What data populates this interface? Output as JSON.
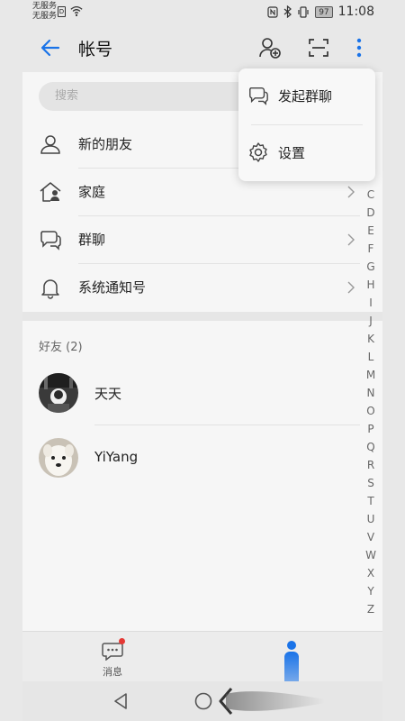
{
  "status_bar": {
    "carrier_line1": "无服务",
    "carrier_line2": "无服务",
    "battery": "97",
    "time": "11:08"
  },
  "header": {
    "title": "帐号",
    "back_icon": "arrow-left-icon",
    "add_friend_icon": "person-add-icon",
    "scan_icon": "scan-icon",
    "more_icon": "more-vertical-icon",
    "accent_color": "#1a73e8"
  },
  "search": {
    "placeholder": "搜索"
  },
  "entries": [
    {
      "label": "新的朋友",
      "icon": "person-icon"
    },
    {
      "label": "家庭",
      "icon": "home-person-icon"
    },
    {
      "label": "群聊",
      "icon": "chat-bubbles-icon"
    },
    {
      "label": "系统通知号",
      "icon": "bell-icon"
    }
  ],
  "friends_section": {
    "title": "好友 (2)",
    "friends": [
      {
        "name": "天天"
      },
      {
        "name": "YiYang"
      }
    ]
  },
  "alphabet_index": [
    "C",
    "D",
    "E",
    "F",
    "G",
    "H",
    "I",
    "J",
    "K",
    "L",
    "M",
    "N",
    "O",
    "P",
    "Q",
    "R",
    "S",
    "T",
    "U",
    "V",
    "W",
    "X",
    "Y",
    "Z"
  ],
  "popup_menu": {
    "items": [
      {
        "label": "发起群聊",
        "icon": "chat-bubbles-icon"
      },
      {
        "label": "设置",
        "icon": "gear-icon"
      }
    ]
  },
  "bottom_tabs": {
    "messages_label": "消息",
    "unread_dot_color": "#e53935"
  }
}
